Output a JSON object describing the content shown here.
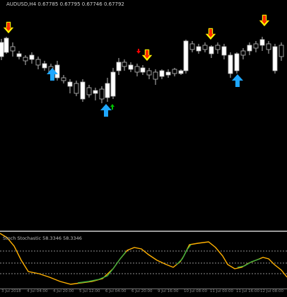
{
  "chart": {
    "title_line": "AUDUSD,H4  0.67785 0.67795 0.67746 0.67792"
  },
  "indicator": {
    "title_line": "Stoch Stochastic 58.3346 58.3346"
  },
  "time_axis": {
    "ticks": [
      "3 Jul 2018",
      "4 Jul 04:00",
      "4 Jul 20:00",
      "5 Jul 12:00",
      "6 Jul 04:00",
      "6 Jul 20:00",
      "9 Jul 16:00",
      "10 Jul 08:00",
      "11 Jul 00:00",
      "11 Jul 16:00",
      "12 Jul 08:00"
    ]
  },
  "colors": {
    "background": "#000000",
    "candle_bull": "#ffffff",
    "candle_bear": "#000000",
    "wick": "#bdbdbd",
    "arrow_down_outer": "#ffff00",
    "arrow_down_inner": "#ff2a00",
    "arrow_up": "#1ea7ff",
    "arrow_small_up": "#00c000",
    "arrow_small_down": "#ff0000",
    "stoch_main": "#ffb000",
    "stoch_rising": "#3cb043",
    "levels": "#bdbdbd"
  },
  "icons": {
    "signal_down": "arrow-down-icon",
    "signal_up": "arrow-up-icon"
  }
}
